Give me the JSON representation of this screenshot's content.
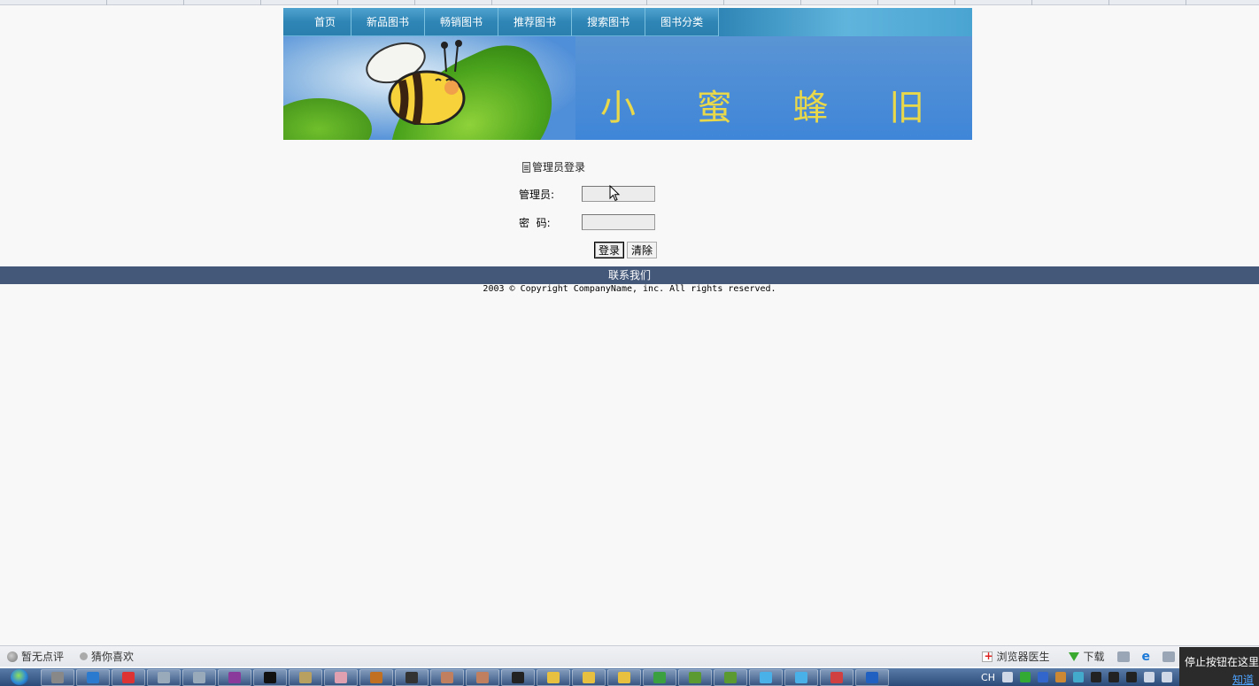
{
  "nav": {
    "items": [
      "首页",
      "新品图书",
      "畅销图书",
      "推荐图书",
      "搜索图书",
      "图书分类"
    ]
  },
  "banner": {
    "title": "小 蜜 蜂 旧书城"
  },
  "login": {
    "title": "管理员登录",
    "admin_label": "管理员:",
    "password_label": "密  码:",
    "admin_value": "",
    "password_value": "",
    "login_button": "登录",
    "clear_button": "清除"
  },
  "footer": {
    "contact": "联系我们",
    "copyright": "2003 © Copyright CompanyName, inc. All rights reserved."
  },
  "statusbar": {
    "no_review": "暂无点评",
    "guess_like": "猜你喜欢",
    "browser_doctor": "浏览器医生",
    "download": "下载"
  },
  "tooltip": {
    "text": "停止按钮在这里",
    "know": "知道"
  },
  "taskbar": {
    "lang": "CH"
  },
  "colors": {
    "nav_blue": "#2f86b6",
    "banner_blue": "#3f86d8",
    "title_yellow": "#e8d84a",
    "footer_bar": "#44587a"
  }
}
